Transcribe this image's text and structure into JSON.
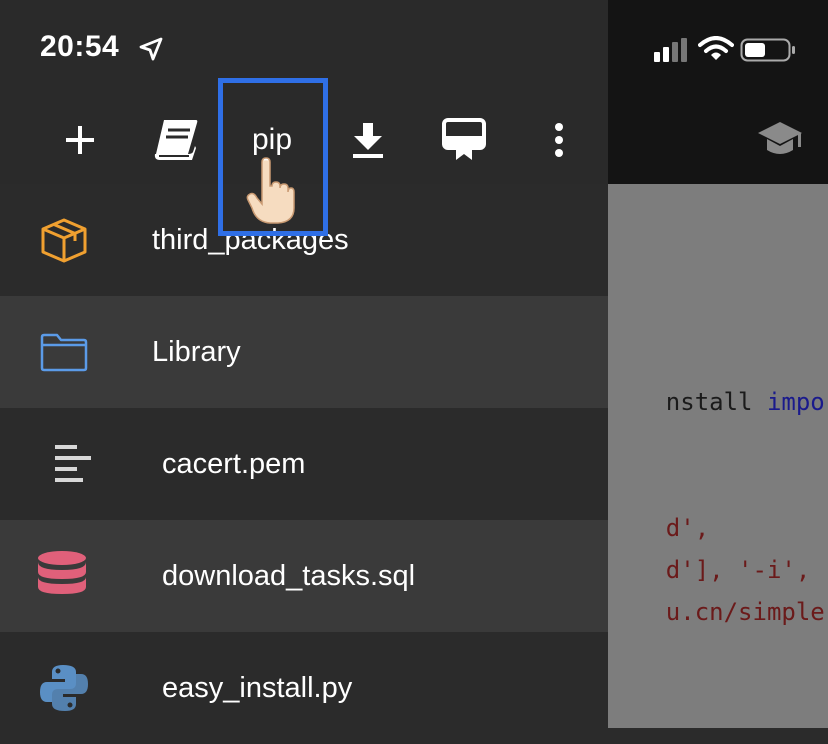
{
  "status_bar": {
    "time": "20:54"
  },
  "toolbar": {
    "pip_label": "pip",
    "icons": [
      "plus-icon",
      "book-icon",
      "download-icon",
      "presentation-icon",
      "more-vertical-icon"
    ]
  },
  "files": [
    {
      "name": "third_packages",
      "icon": "package-icon",
      "icon_color": "#f0a030"
    },
    {
      "name": "Library",
      "icon": "folder-icon",
      "icon_color": "#5b9be8"
    },
    {
      "name": "cacert.pem",
      "icon": "text-file-icon",
      "icon_color": "#d8d8d8"
    },
    {
      "name": "download_tasks.sql",
      "icon": "database-icon",
      "icon_color": "#e0607a"
    },
    {
      "name": "easy_install.py",
      "icon": "python-icon",
      "icon_color": "#5a8fc4"
    }
  ],
  "code": {
    "line1_a": "nstall ",
    "line1_b": "import",
    "line2": "d',",
    "line3_a": "d'], ",
    "line3_b": "'-i',",
    "line4_a": "u.cn/simple'",
    "line4_b": ","
  },
  "colors": {
    "highlight": "#2f6fe6",
    "drawer_bg": "#2b2b2b",
    "row_alt_bg": "#3a3a3a"
  }
}
